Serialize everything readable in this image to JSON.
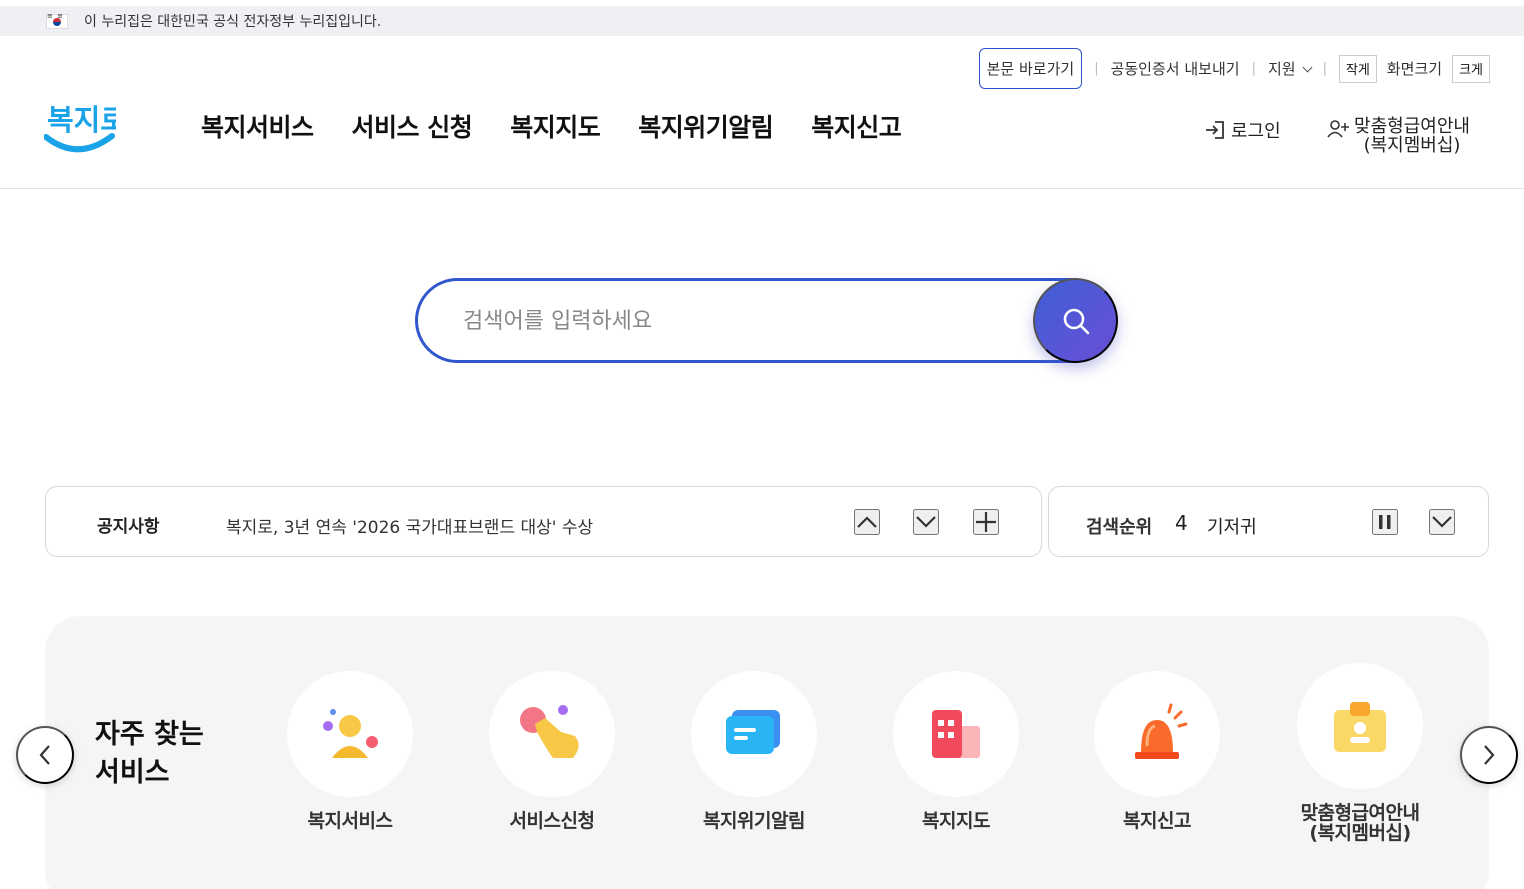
{
  "gov_banner": {
    "text": "이 누리집은 대한민국 공식 전자정부 누리집입니다."
  },
  "util": {
    "skip_link": "본문 바로가기",
    "cert_export": "공동인증서 내보내기",
    "support": "지원",
    "size_small": "작게",
    "size_label": "화면크기",
    "size_large": "크게"
  },
  "logo": {
    "text": "복지로"
  },
  "gnb": [
    "복지서비스",
    "서비스 신청",
    "복지지도",
    "복지위기알림",
    "복지신고"
  ],
  "header_actions": {
    "login": "로그인",
    "membership_line1": "맞춤형급여안내",
    "membership_line2": "(복지멤버십)"
  },
  "search": {
    "placeholder": "검색어를 입력하세요"
  },
  "notice": {
    "label": "공지사항",
    "text": "복지로, 3년 연속 '2026 국가대표브랜드 대상' 수상"
  },
  "search_rank": {
    "label": "검색순위",
    "number": "4",
    "keyword": "기저귀"
  },
  "favorites": {
    "title": "자주 찾는 서비스",
    "items": [
      {
        "label": "복지서비스",
        "icon": "person-icon"
      },
      {
        "label": "서비스신청",
        "icon": "tap-hand-icon"
      },
      {
        "label": "복지위기알림",
        "icon": "message-icon"
      },
      {
        "label": "복지지도",
        "icon": "building-icon"
      },
      {
        "label": "복지신고",
        "icon": "siren-icon"
      },
      {
        "label": "맞춤형급여안내(복지멤버십)",
        "icon": "id-badge-icon"
      }
    ]
  },
  "colors": {
    "accent": "#3157cf",
    "logo_blue": "#1aa3e8",
    "favorites_bg": "#f5f5f7"
  }
}
